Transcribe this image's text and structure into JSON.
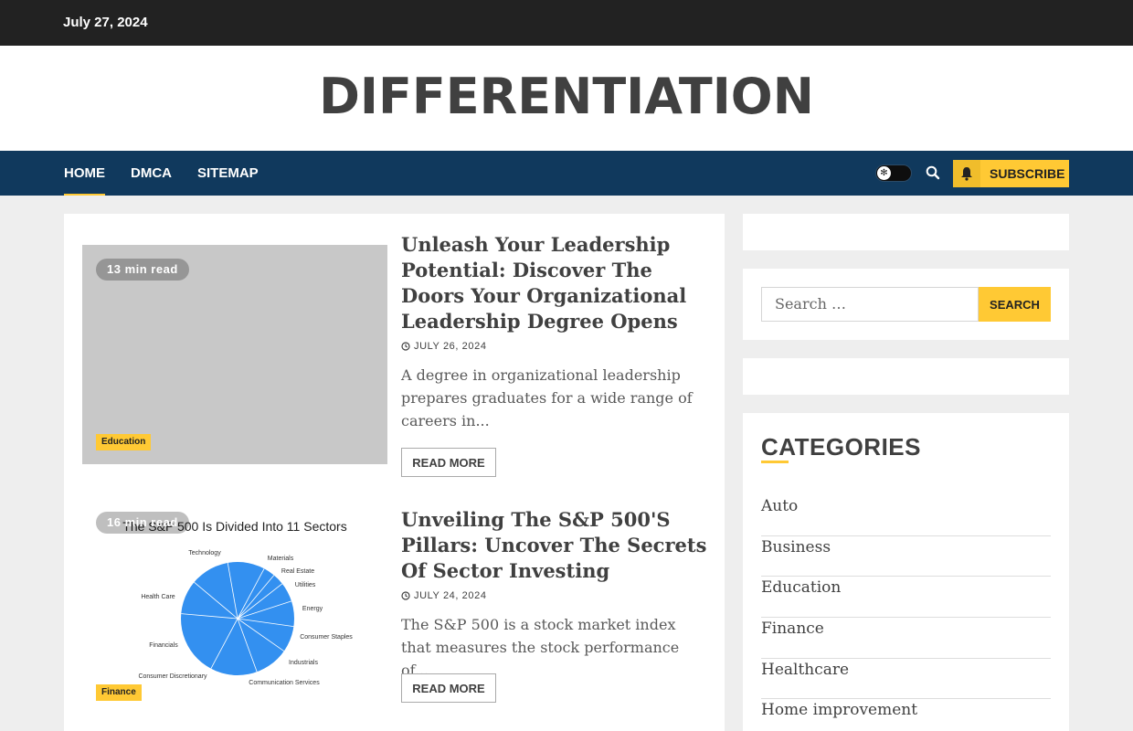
{
  "topbar": {
    "date": "July 27, 2024"
  },
  "site": {
    "title": "DIFFERENTIATION"
  },
  "nav": {
    "items": [
      {
        "label": "HOME",
        "active": true
      },
      {
        "label": "DMCA",
        "active": false
      },
      {
        "label": "SITEMAP",
        "active": false
      }
    ],
    "subscribe_label": "SUBSCRIBE",
    "icons": [
      "sun-icon",
      "search-icon",
      "bell-icon"
    ]
  },
  "posts": [
    {
      "read_time": "13 min read",
      "category": "Education",
      "title": "Unleash Your Leadership Potential: Discover The Doors Your Organizational Leadership Degree Opens",
      "date": "JULY 26, 2024",
      "excerpt": "A degree in organizational leadership prepares graduates for a wide range of careers in...",
      "read_more": "READ MORE"
    },
    {
      "read_time": "16 min read",
      "category": "Finance",
      "title": "Unveiling The S&P 500'S Pillars: Uncover The Secrets Of Sector Investing",
      "date": "JULY 24, 2024",
      "excerpt": "The S&P 500 is a stock market index that measures the stock performance of...",
      "read_more": "READ MORE",
      "image": {
        "title": "The S&P 500 Is Divided Into 11 Sectors",
        "sectors": [
          "Technology",
          "Materials",
          "Real Estate",
          "Utilities",
          "Energy",
          "Consumer Staples",
          "Industrials",
          "Communication Services",
          "Consumer Discretionary",
          "Financials",
          "Health Care"
        ],
        "color": "#3390f0"
      }
    }
  ],
  "sidebar": {
    "search_placeholder": "Search …",
    "search_button": "SEARCH",
    "categories_heading": "CATEGORIES",
    "categories": [
      "Auto",
      "Business",
      "Education",
      "Finance",
      "Healthcare",
      "Home improvement"
    ]
  },
  "colors": {
    "navbar": "#10395d",
    "accent": "#ffc934",
    "topbar": "#222222"
  }
}
